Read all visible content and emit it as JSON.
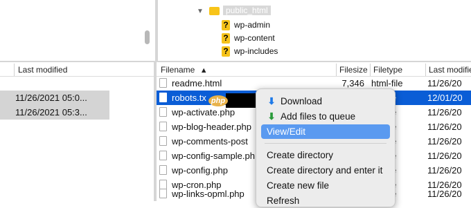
{
  "tree": {
    "root": "public_html",
    "children": [
      "wp-admin",
      "wp-content",
      "wp-includes"
    ]
  },
  "left_pane": {
    "header_last_modified": "Last modified",
    "dates": [
      "11/26/2021 05:0...",
      "11/26/2021 05:3..."
    ]
  },
  "right_pane": {
    "headers": {
      "filename": "Filename",
      "filesize": "Filesize",
      "filetype": "Filetype",
      "last_modified": "Last modifie"
    },
    "rows": [
      {
        "name": "readme.html",
        "size": "7,346",
        "type": "html-file",
        "date": "11/26/20"
      },
      {
        "name": "robots.tx",
        "size": "",
        "type": "e",
        "date": "12/01/20"
      },
      {
        "name": "wp-activate.php",
        "size": "",
        "type": "e",
        "date": "11/26/20"
      },
      {
        "name": "wp-blog-header.php",
        "size": "",
        "type": "e",
        "date": "11/26/20"
      },
      {
        "name": "wp-comments-post",
        "size": "",
        "type": "e",
        "date": "11/26/20"
      },
      {
        "name": "wp-config-sample.ph",
        "size": "",
        "type": "e",
        "date": "11/26/20"
      },
      {
        "name": "wp-config.php",
        "size": "",
        "type": "e",
        "date": "11/26/20"
      },
      {
        "name": "wp-cron.php",
        "size": "",
        "type": "e",
        "date": "11/26/20"
      },
      {
        "name": "wp-links-opml.php",
        "size": "",
        "type": "e",
        "date": "11/26/20"
      }
    ],
    "selected_index": 1
  },
  "php_badge": "php",
  "context_menu": {
    "items": [
      "Download",
      "Add files to queue",
      "View/Edit",
      "Create directory",
      "Create directory and enter it",
      "Create new file",
      "Refresh"
    ],
    "highlighted": "View/Edit"
  },
  "colors": {
    "selection": "#0a5dd6",
    "menu_highlight": "#5a9af0"
  }
}
